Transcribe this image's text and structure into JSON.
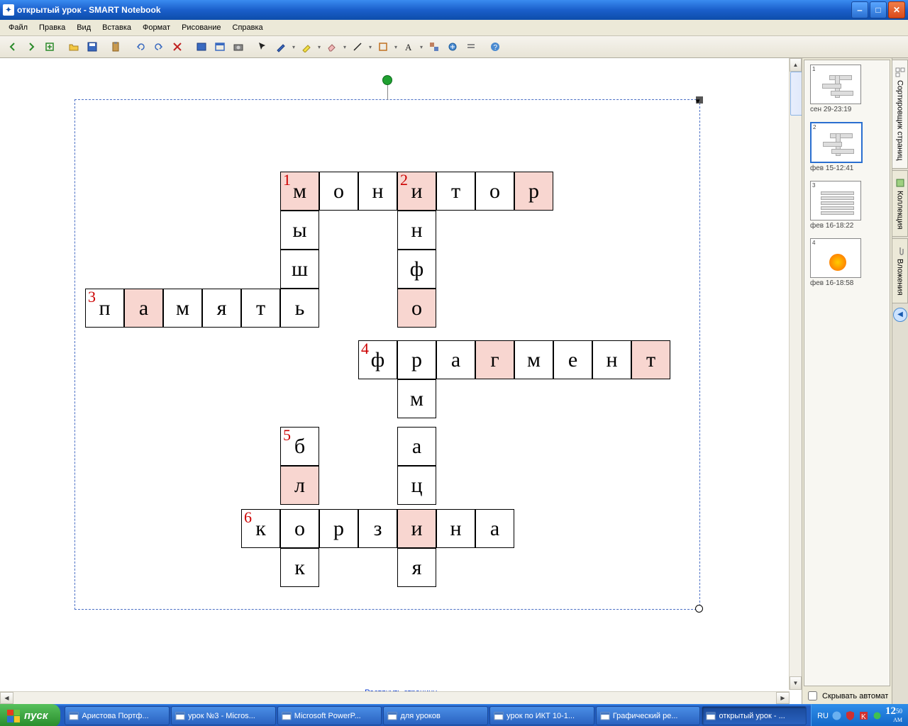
{
  "title": "открытый урок - SMART Notebook",
  "menu": [
    "Файл",
    "Правка",
    "Вид",
    "Вставка",
    "Формат",
    "Рисование",
    "Справка"
  ],
  "stretch_link": "Растянуть страницу",
  "side_tabs": [
    "Сортировщик страниц",
    "Коллекция",
    "Вложения"
  ],
  "hide_auto": "Скрывать автомат",
  "thumbs": [
    {
      "num": "1",
      "caption": "сен 29-23:19",
      "selected": false
    },
    {
      "num": "2",
      "caption": "фев 15-12:41",
      "selected": true
    },
    {
      "num": "3",
      "caption": "фев 16-18:22",
      "selected": false
    },
    {
      "num": "4",
      "caption": "фев 16-18:58",
      "selected": false
    }
  ],
  "taskbar": {
    "start": "пуск",
    "items": [
      "Аристова Портф...",
      "урок №3 - Micros...",
      "Microsoft PowerP...",
      "для уроков",
      "урок по ИКТ 10-1...",
      "Графический ре...",
      "открытый урок - ..."
    ],
    "lang": "RU",
    "time": "12",
    "minutes": "50",
    "ampm": "AM"
  },
  "crossword": {
    "cell_size": 55,
    "cells": [
      {
        "r": 0,
        "c": 5,
        "ch": "м",
        "num": "1",
        "hl": true
      },
      {
        "r": 0,
        "c": 6,
        "ch": "о"
      },
      {
        "r": 0,
        "c": 7,
        "ch": "н"
      },
      {
        "r": 0,
        "c": 8,
        "ch": "и",
        "num": "2",
        "hl": true
      },
      {
        "r": 0,
        "c": 9,
        "ch": "т"
      },
      {
        "r": 0,
        "c": 10,
        "ch": "о"
      },
      {
        "r": 0,
        "c": 11,
        "ch": "р",
        "hl": true
      },
      {
        "r": 1,
        "c": 5,
        "ch": "ы"
      },
      {
        "r": 1,
        "c": 8,
        "ch": "н"
      },
      {
        "r": 2,
        "c": 5,
        "ch": "ш"
      },
      {
        "r": 2,
        "c": 8,
        "ch": "ф"
      },
      {
        "r": 3,
        "c": 0,
        "ch": "п",
        "num": "3"
      },
      {
        "r": 3,
        "c": 1,
        "ch": "а",
        "hl": true
      },
      {
        "r": 3,
        "c": 2,
        "ch": "м"
      },
      {
        "r": 3,
        "c": 3,
        "ch": "я"
      },
      {
        "r": 3,
        "c": 4,
        "ch": "т"
      },
      {
        "r": 3,
        "c": 5,
        "ch": "ь"
      },
      {
        "r": 3,
        "c": 8,
        "ch": "о",
        "hl": true
      },
      {
        "r": 4,
        "c": 7,
        "ch": "ф",
        "num": "4"
      },
      {
        "r": 4,
        "c": 8,
        "ch": "р"
      },
      {
        "r": 4,
        "c": 9,
        "ch": "а"
      },
      {
        "r": 4,
        "c": 10,
        "ch": "г",
        "hl": true
      },
      {
        "r": 4,
        "c": 11,
        "ch": "м"
      },
      {
        "r": 4,
        "c": 12,
        "ch": "е"
      },
      {
        "r": 4,
        "c": 13,
        "ch": "н"
      },
      {
        "r": 4,
        "c": 14,
        "ch": "т",
        "hl": true
      },
      {
        "r": 5,
        "c": 8,
        "ch": "м"
      },
      {
        "r": 6,
        "c": 5,
        "ch": "б",
        "num": "5"
      },
      {
        "r": 6,
        "c": 8,
        "ch": "а"
      },
      {
        "r": 7,
        "c": 5,
        "ch": "л",
        "hl": true
      },
      {
        "r": 7,
        "c": 8,
        "ch": "ц"
      },
      {
        "r": 8,
        "c": 4,
        "ch": "к",
        "num": "6"
      },
      {
        "r": 8,
        "c": 5,
        "ch": "о"
      },
      {
        "r": 8,
        "c": 6,
        "ch": "р"
      },
      {
        "r": 8,
        "c": 7,
        "ch": "з"
      },
      {
        "r": 8,
        "c": 8,
        "ch": "и",
        "hl": true
      },
      {
        "r": 8,
        "c": 9,
        "ch": "н"
      },
      {
        "r": 8,
        "c": 10,
        "ch": "а"
      },
      {
        "r": 9,
        "c": 5,
        "ch": "к"
      },
      {
        "r": 9,
        "c": 8,
        "ch": "я"
      }
    ]
  }
}
